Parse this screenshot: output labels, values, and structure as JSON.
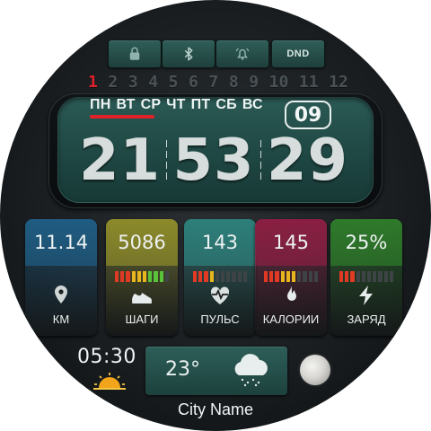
{
  "top_buttons": {
    "dnd_label": "DND"
  },
  "months": [
    "1",
    "2",
    "3",
    "4",
    "5",
    "6",
    "7",
    "8",
    "9",
    "10",
    "11",
    "12"
  ],
  "active_month": "1",
  "days": [
    "ПН",
    "ВТ",
    "СР",
    "ЧТ",
    "ПТ",
    "СБ",
    "ВС"
  ],
  "date": "09",
  "time": {
    "hours": "21",
    "minutes": "53",
    "seconds": "29"
  },
  "tiles": [
    {
      "value": "11.14",
      "label": "КМ",
      "icon": "location-pin-icon",
      "color": "#1f5c82",
      "fill": 0
    },
    {
      "value": "5086",
      "label": "ШАГИ",
      "icon": "shoe-icon",
      "color": "#8c8a2a",
      "fill": 0.9
    },
    {
      "value": "143",
      "label": "ПУЛЬС",
      "icon": "heart-pulse-icon",
      "color": "#2d7f7a",
      "fill": 0.4
    },
    {
      "value": "145",
      "label": "КАЛОРИИ",
      "icon": "flame-icon",
      "color": "#8a1f42",
      "fill": 0.55
    },
    {
      "value": "25%",
      "label": "ЗАРЯД",
      "icon": "lightning-icon",
      "color": "#2e7a2a",
      "fill": 0.25
    }
  ],
  "small_time": "05:30",
  "weather": {
    "temperature": "23°",
    "icon": "cloud-snow-icon"
  },
  "city": "City Name",
  "colors": {
    "accent_red": "#e0212a",
    "panel_teal": "#1f4743"
  }
}
